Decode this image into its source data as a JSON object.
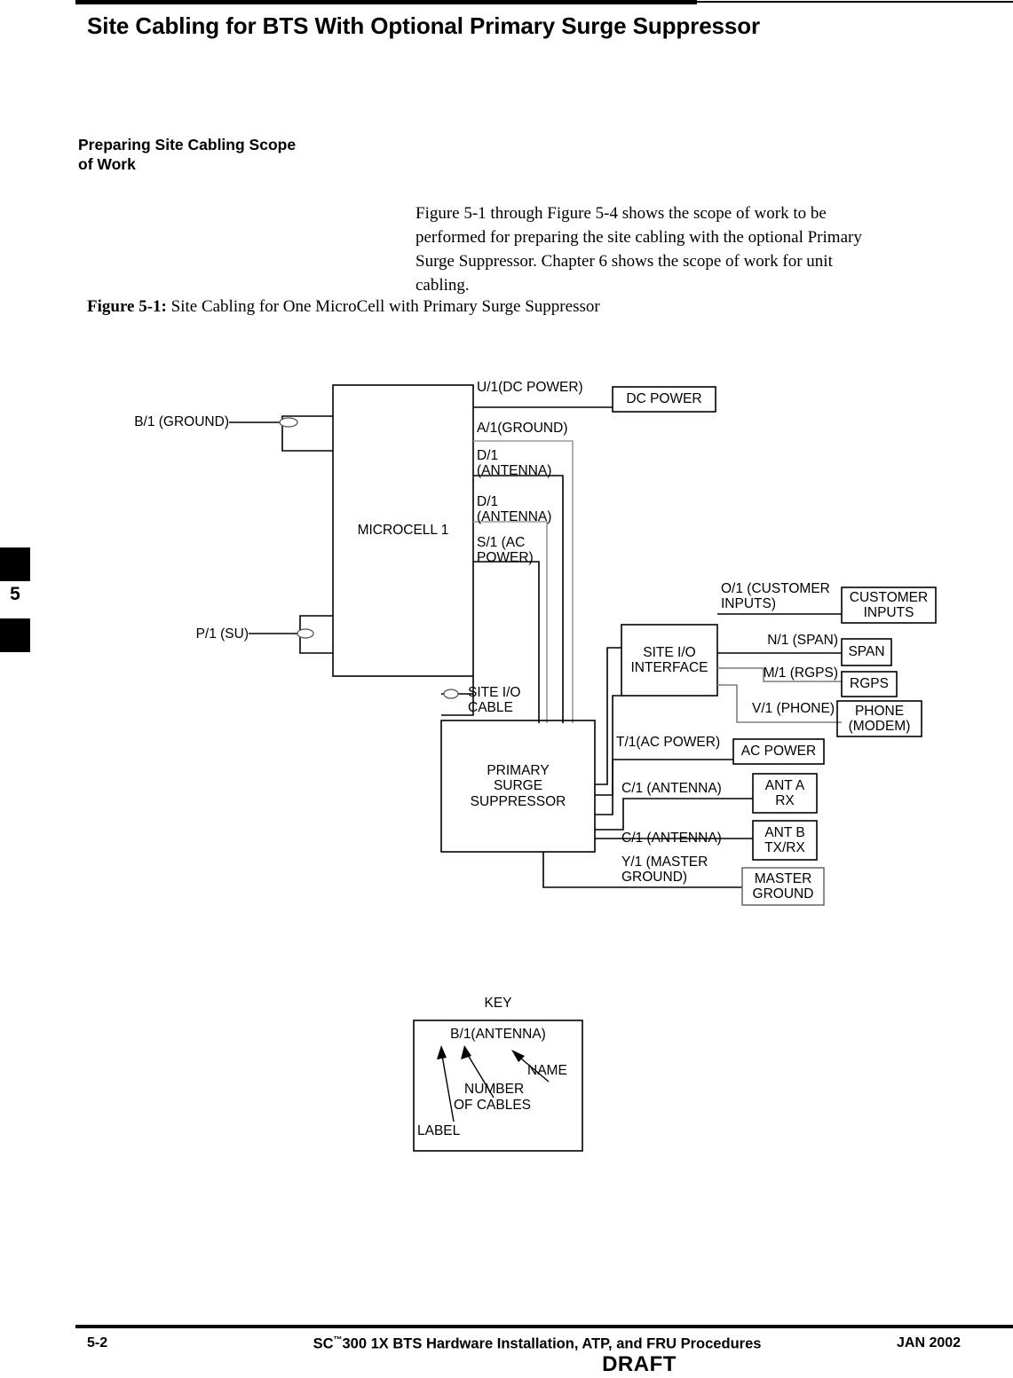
{
  "header": {
    "title": "Site Cabling for BTS With Optional Primary Surge Suppressor"
  },
  "section": {
    "heading_line1": "Preparing Site Cabling Scope",
    "heading_line2": "of Work",
    "paragraph": "Figure 5-1 through Figure 5-4 shows the scope of work to be performed for preparing the site cabling with the optional Primary Surge Suppressor.  Chapter 6 shows the scope of work for unit cabling."
  },
  "figure": {
    "caption_label": "Figure 5-1:",
    "caption_text": " Site Cabling for One MicroCell with Primary Surge Suppressor"
  },
  "chapter_tab": {
    "number": "5"
  },
  "footer": {
    "page": "5-2",
    "title_prefix": "SC",
    "title_tm": "™",
    "title_rest": "300 1X BTS Hardware Installation, ATP, and FRU Procedures",
    "date": "JAN 2002",
    "draft": "DRAFT"
  },
  "diagram": {
    "blocks": {
      "microcell": "MICROCELL 1",
      "site_io_interface_l1": "SITE I/O",
      "site_io_interface_l2": "INTERFACE",
      "surge_l1": "PRIMARY",
      "surge_l2": "SURGE",
      "surge_l3": "SUPPRESSOR",
      "dc_power": "DC POWER",
      "customer_inputs_l1": "CUSTOMER",
      "customer_inputs_l2": "INPUTS",
      "span": "SPAN",
      "rgps": "RGPS",
      "phone_l1": "PHONE",
      "phone_l2": "(MODEM)",
      "ac_power": "AC POWER",
      "ant_a_l1": "ANT A",
      "ant_a_l2": "RX",
      "ant_b_l1": "ANT B",
      "ant_b_l2": "TX/RX",
      "master_ground_l1": "MASTER",
      "master_ground_l2": "GROUND"
    },
    "cable_labels": {
      "b1_ground": "B/1 (GROUND)",
      "p1_su": "P/1 (SU)",
      "u1_dc_power": "U/1(DC POWER)",
      "a1_ground": "A/1(GROUND)",
      "d1_antenna_a": "D/1\n(ANTENNA)",
      "d1_antenna_b": "D/1\n(ANTENNA)",
      "s1_ac_power": "S/1 (AC\nPOWER)",
      "site_io_cable": "SITE I/O\nCABLE",
      "o1_customer_inputs": "O/1 (CUSTOMER\nINPUTS)",
      "n1_span": "N/1 (SPAN)",
      "m1_rgps": "M/1 (RGPS)",
      "v1_phone": "V/1 (PHONE)",
      "t1_ac_power": "T/1(AC POWER)",
      "c1_antenna_a": "C/1 (ANTENNA)",
      "c1_antenna_b": "C/1 (ANTENNA)",
      "y1_master_ground": "Y/1 (MASTER\nGROUND)"
    },
    "key": {
      "title": "KEY",
      "sample": "B/1(ANTENNA)",
      "name": "NAME",
      "number_l1": "NUMBER",
      "number_l2": "OF CABLES",
      "label": "LABEL"
    }
  }
}
